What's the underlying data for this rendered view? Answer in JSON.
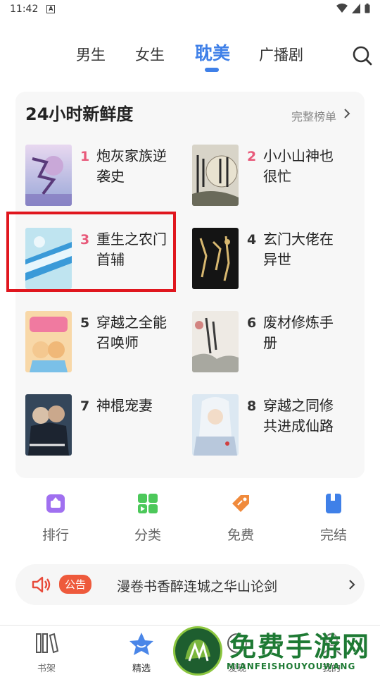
{
  "status_bar": {
    "time": "11:42"
  },
  "top_tabs": [
    {
      "label": "男生"
    },
    {
      "label": "女生"
    },
    {
      "label": "耽美"
    },
    {
      "label": "广播剧"
    }
  ],
  "ranking": {
    "title": "24小时新鲜度",
    "more_label": "完整榜单",
    "books": [
      {
        "rank": "1",
        "title": "炮灰家族逆袭史"
      },
      {
        "rank": "2",
        "title": "小小山神也很忙"
      },
      {
        "rank": "3",
        "title": "重生之农门首辅"
      },
      {
        "rank": "4",
        "title": "玄门大佬在异世"
      },
      {
        "rank": "5",
        "title": "穿越之全能召唤师"
      },
      {
        "rank": "6",
        "title": "废材修炼手册"
      },
      {
        "rank": "7",
        "title": "神棍宠妻"
      },
      {
        "rank": "8",
        "title": "穿越之同修共进成仙路"
      }
    ]
  },
  "quick_nav": [
    {
      "label": "排行",
      "icon": "ranking-icon",
      "color": "#a070f0"
    },
    {
      "label": "分类",
      "icon": "category-icon",
      "color": "#4cc85a"
    },
    {
      "label": "免费",
      "icon": "tag-icon",
      "color": "#f08a3c"
    },
    {
      "label": "完结",
      "icon": "book-icon",
      "color": "#3f80e8"
    }
  ],
  "notice": {
    "badge": "公告",
    "text": "漫卷书香醉连城之华山论剑"
  },
  "bottom_nav": [
    {
      "label": "书架",
      "icon": "bookshelf-icon"
    },
    {
      "label": "精选",
      "icon": "star-icon",
      "active": true
    },
    {
      "label": "发现",
      "icon": "discover-icon"
    },
    {
      "label": "我的",
      "icon": "profile-icon"
    }
  ],
  "watermark": {
    "title": "免费手游网",
    "subtitle": "MIANFEISHOUYOUWANG"
  }
}
